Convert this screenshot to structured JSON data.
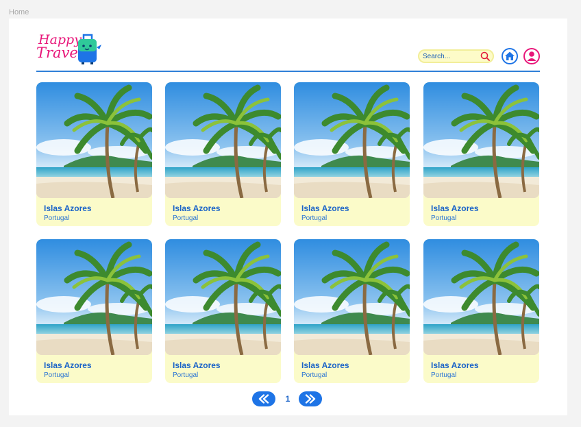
{
  "frame_label": "Home",
  "logo": {
    "line1": "Happy",
    "line2": "Travel"
  },
  "search": {
    "placeholder": "Search..."
  },
  "icons": {
    "search": "search-icon",
    "home": "home-icon",
    "user": "user-icon",
    "prev": "double-chevron-left-icon",
    "next": "double-chevron-right-icon"
  },
  "colors": {
    "brand_pink": "#e8177a",
    "accent_blue": "#1e74e6",
    "card_bg": "#fbfbc9"
  },
  "destinations": [
    {
      "title": "Islas Azores",
      "subtitle": "Portugal"
    },
    {
      "title": "Islas Azores",
      "subtitle": "Portugal"
    },
    {
      "title": "Islas Azores",
      "subtitle": "Portugal"
    },
    {
      "title": "Islas Azores",
      "subtitle": "Portugal"
    },
    {
      "title": "Islas Azores",
      "subtitle": "Portugal"
    },
    {
      "title": "Islas Azores",
      "subtitle": "Portugal"
    },
    {
      "title": "Islas Azores",
      "subtitle": "Portugal"
    },
    {
      "title": "Islas Azores",
      "subtitle": "Portugal"
    }
  ],
  "pagination": {
    "current_page": "1"
  }
}
